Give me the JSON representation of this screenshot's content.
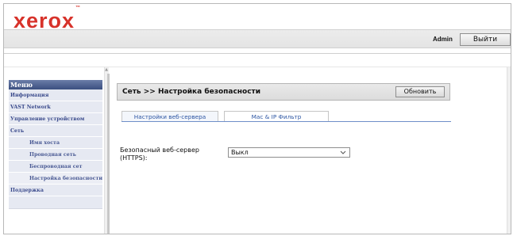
{
  "brand": {
    "logo": "xerox",
    "logo_mark": "™",
    "color": "#d7322a"
  },
  "header": {
    "user": "Admin",
    "logout_label": "Выйти"
  },
  "menu": {
    "title": "Меню",
    "items": [
      {
        "label": "Информация",
        "level": 0
      },
      {
        "label": "VAST Network",
        "level": 0
      },
      {
        "label": "Управление устройством",
        "level": 0
      },
      {
        "label": "Сеть",
        "level": 0
      },
      {
        "label": "Имя хоста",
        "level": 1
      },
      {
        "label": "Проводная сеть",
        "level": 1
      },
      {
        "label": "Беспроводная сет",
        "level": 1
      },
      {
        "label": "Настройка безопасности",
        "level": 1
      },
      {
        "label": "Поддержка",
        "level": 0
      }
    ]
  },
  "content": {
    "title": "Сеть >> Настройка безопасности",
    "refresh_label": "Обновить",
    "tabs": [
      {
        "label": "Настройки веб-сервера",
        "active": true
      },
      {
        "label": "Mac & IP Фильтр",
        "active": false
      }
    ],
    "https_field": {
      "label_line1": "Безопасный веб-сервер",
      "label_line2": "(HTTPS):",
      "value": "Выкл"
    }
  },
  "colors": {
    "menu_header": "#3b4f80",
    "menu_item_bg": "#e6e9f2",
    "menu_text": "#3a4a8c",
    "tab_text": "#2d56a3"
  }
}
